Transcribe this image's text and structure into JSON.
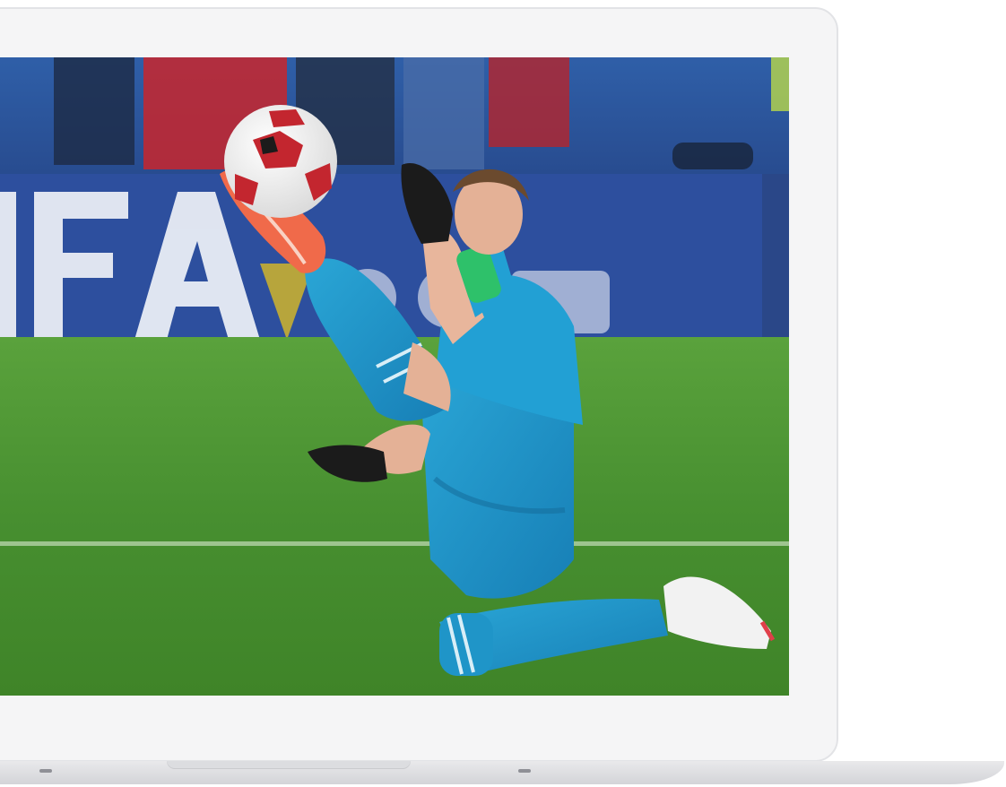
{
  "device": "laptop-mockup",
  "screen": {
    "image_subject": "goalkeeper-kick-save-photo",
    "banner_text": "FIFA.com"
  },
  "colors": {
    "bezel": "#f5f5f6",
    "base": "#d9dadd",
    "pitch": "#4f9a35",
    "banner": "#2e4f9c",
    "kit": "#1f8fc4"
  }
}
